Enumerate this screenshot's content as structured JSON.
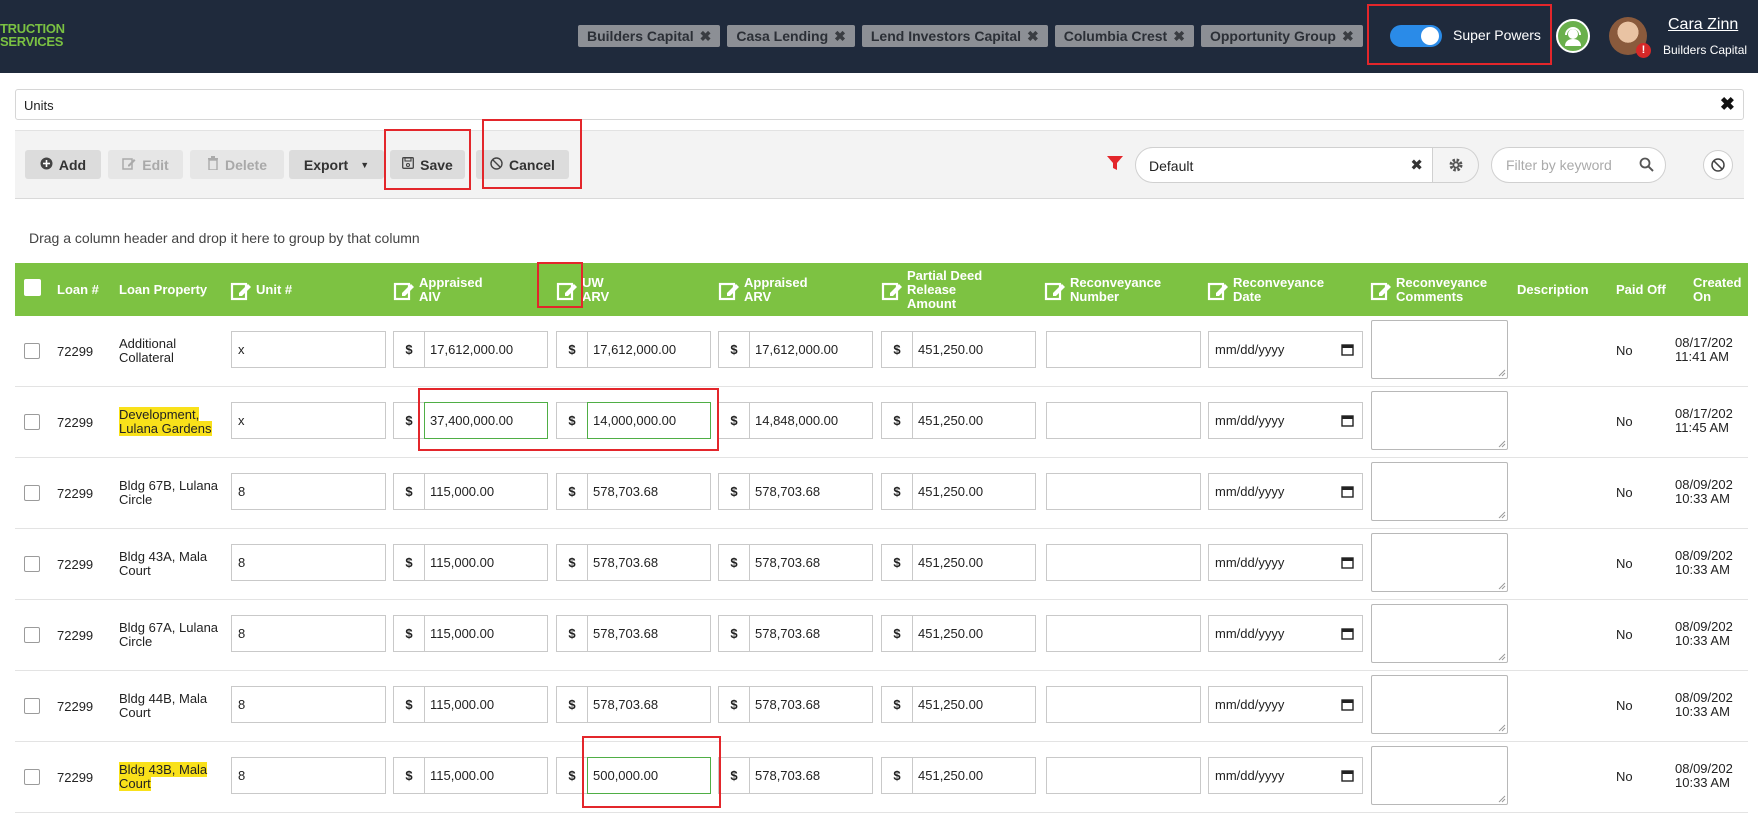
{
  "header": {
    "logo_line1": "TRUCTION",
    "logo_line2": "SERVICES",
    "lender_chips": [
      "Builders Capital",
      "Casa Lending",
      "Lend Investors Capital",
      "Columbia Crest",
      "Opportunity Group"
    ],
    "super_powers_label": "Super Powers",
    "super_powers_on": true,
    "user_name": "Cara Zinn",
    "user_company": "Builders Capital",
    "alert_badge": "!"
  },
  "panel": {
    "title": "Units"
  },
  "toolbar": {
    "add_label": "Add",
    "edit_label": "Edit",
    "delete_label": "Delete",
    "export_label": "Export",
    "save_label": "Save",
    "cancel_label": "Cancel",
    "view_value": "Default",
    "keyword_placeholder": "Filter by keyword"
  },
  "grid": {
    "group_hint": "Drag a column header and drop it here to group by that column",
    "columns": {
      "loan": "Loan #",
      "property": "Loan Property",
      "unit": "Unit #",
      "appraised_aiv": "Appraised AIV",
      "uw_arv": "UW ARV",
      "appraised_arv": "Appraised ARV",
      "partial_deed": "Partial Deed Release Amount",
      "reconveyance_number": "Reconveyance Number",
      "reconveyance_date": "Reconveyance Date",
      "reconveyance_comments": "Reconveyance Comments",
      "description": "Description",
      "paid_off": "Paid Off",
      "created_on": "Created On"
    },
    "currency_symbol": "$",
    "date_placeholder": "mm/dd/yyyy",
    "rows": [
      {
        "loan": "72299",
        "property_line1": "Additional",
        "property_line2": "Collateral",
        "highlight": false,
        "unit": "x",
        "appraised_aiv": "17,612,000.00",
        "uw_arv": "17,612,000.00",
        "appraised_arv": "17,612,000.00",
        "partial_deed": "451,250.00",
        "paid_off": "No",
        "created_date": "08/17/202",
        "created_time": "11:41 AM"
      },
      {
        "loan": "72299",
        "property_line1": "Development,",
        "property_line2": "Lulana Gardens",
        "highlight": true,
        "unit": "x",
        "appraised_aiv": "37,400,000.00",
        "uw_arv": "14,000,000.00",
        "appraised_arv": "14,848,000.00",
        "partial_deed": "451,250.00",
        "paid_off": "No",
        "created_date": "08/17/202",
        "created_time": "11:45 AM"
      },
      {
        "loan": "72299",
        "property_line1": "Bldg 67B, Lulana",
        "property_line2": "Circle",
        "highlight": false,
        "unit": "8",
        "appraised_aiv": "115,000.00",
        "uw_arv": "578,703.68",
        "appraised_arv": "578,703.68",
        "partial_deed": "451,250.00",
        "paid_off": "No",
        "created_date": "08/09/202",
        "created_time": "10:33 AM"
      },
      {
        "loan": "72299",
        "property_line1": "Bldg 43A, Mala",
        "property_line2": "Court",
        "highlight": false,
        "unit": "8",
        "appraised_aiv": "115,000.00",
        "uw_arv": "578,703.68",
        "appraised_arv": "578,703.68",
        "partial_deed": "451,250.00",
        "paid_off": "No",
        "created_date": "08/09/202",
        "created_time": "10:33 AM"
      },
      {
        "loan": "72299",
        "property_line1": "Bldg 67A, Lulana",
        "property_line2": "Circle",
        "highlight": false,
        "unit": "8",
        "appraised_aiv": "115,000.00",
        "uw_arv": "578,703.68",
        "appraised_arv": "578,703.68",
        "partial_deed": "451,250.00",
        "paid_off": "No",
        "created_date": "08/09/202",
        "created_time": "10:33 AM"
      },
      {
        "loan": "72299",
        "property_line1": "Bldg 44B, Mala",
        "property_line2": "Court",
        "highlight": false,
        "unit": "8",
        "appraised_aiv": "115,000.00",
        "uw_arv": "578,703.68",
        "appraised_arv": "578,703.68",
        "partial_deed": "451,250.00",
        "paid_off": "No",
        "created_date": "08/09/202",
        "created_time": "10:33 AM"
      },
      {
        "loan": "72299",
        "property_line1": "Bldg 43B, Mala",
        "property_line2": "Court",
        "highlight": true,
        "unit": "8",
        "appraised_aiv": "115,000.00",
        "uw_arv": "500,000.00",
        "appraised_arv": "578,703.68",
        "partial_deed": "451,250.00",
        "paid_off": "No",
        "created_date": "08/09/202",
        "created_time": "10:33 AM"
      }
    ]
  },
  "colors": {
    "topbar": "#1f2a3c",
    "grid_header": "#7dc242",
    "annotation_red": "#e3262b",
    "highlight_yellow": "#f9e11a",
    "toggle_blue": "#2a8be8"
  }
}
